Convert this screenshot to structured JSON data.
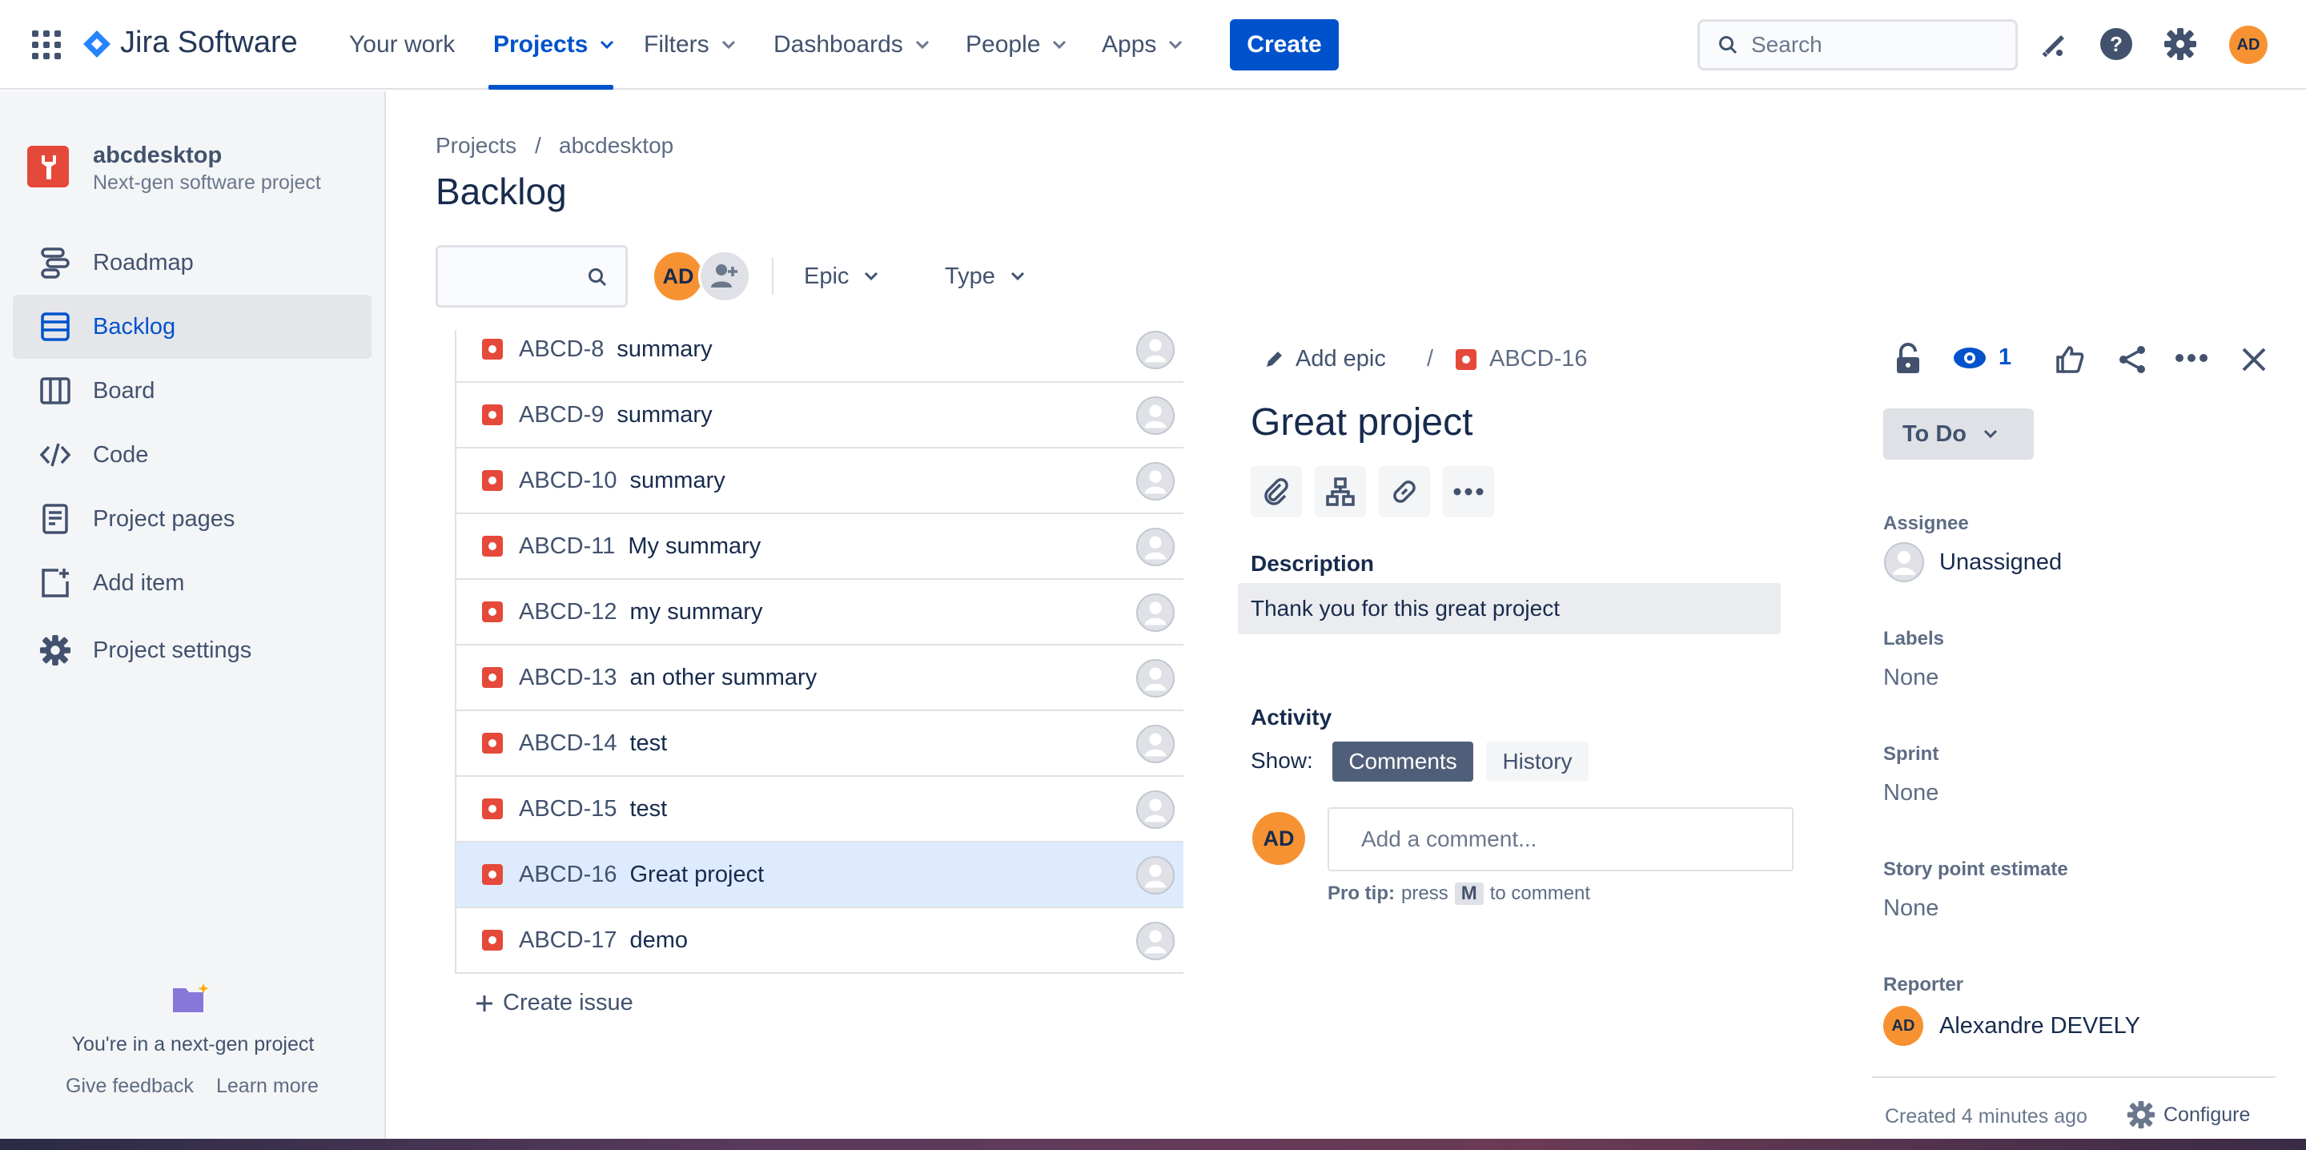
{
  "topnav": {
    "brand": "Jira Software",
    "items": [
      {
        "label": "Your work"
      },
      {
        "label": "Projects"
      },
      {
        "label": "Filters"
      },
      {
        "label": "Dashboards"
      },
      {
        "label": "People"
      },
      {
        "label": "Apps"
      }
    ],
    "create_label": "Create",
    "search_placeholder": "Search",
    "avatar_initials": "AD"
  },
  "sidebar": {
    "project_name": "abcdesktop",
    "project_type": "Next-gen software project",
    "items": [
      {
        "label": "Roadmap"
      },
      {
        "label": "Backlog"
      },
      {
        "label": "Board"
      },
      {
        "label": "Code"
      },
      {
        "label": "Project pages"
      },
      {
        "label": "Add item"
      },
      {
        "label": "Project settings"
      }
    ],
    "footer_text": "You're in a next-gen project",
    "give_feedback": "Give feedback",
    "learn_more": "Learn more"
  },
  "main": {
    "breadcrumb": [
      "Projects",
      "abcdesktop"
    ],
    "breadcrumb_sep": "/",
    "title": "Backlog",
    "filter_avatar": "AD",
    "filters": {
      "epic": "Epic",
      "type": "Type"
    },
    "issues": [
      {
        "key": "ABCD-8",
        "summary": "summary"
      },
      {
        "key": "ABCD-9",
        "summary": "summary"
      },
      {
        "key": "ABCD-10",
        "summary": "summary"
      },
      {
        "key": "ABCD-11",
        "summary": "My summary"
      },
      {
        "key": "ABCD-12",
        "summary": "my summary"
      },
      {
        "key": "ABCD-13",
        "summary": "an other summary"
      },
      {
        "key": "ABCD-14",
        "summary": "test"
      },
      {
        "key": "ABCD-15",
        "summary": "test"
      },
      {
        "key": "ABCD-16",
        "summary": "Great project"
      },
      {
        "key": "ABCD-17",
        "summary": "demo"
      }
    ],
    "create_issue": "Create issue"
  },
  "detail": {
    "add_epic": "Add epic",
    "sep": "/",
    "issue_key": "ABCD-16",
    "watch_count": "1",
    "title": "Great project",
    "description_label": "Description",
    "description": "Thank you for this great project",
    "activity_label": "Activity",
    "show_label": "Show:",
    "comments_tab": "Comments",
    "history_tab": "History",
    "comment_avatar": "AD",
    "comment_placeholder": "Add a comment...",
    "pro_tip_bold": "Pro tip:",
    "pro_tip_press": "press",
    "pro_tip_key": "M",
    "pro_tip_rest": "to comment",
    "status": "To Do",
    "assignee_label": "Assignee",
    "assignee": "Unassigned",
    "labels_label": "Labels",
    "labels": "None",
    "sprint_label": "Sprint",
    "sprint": "None",
    "story_label": "Story point estimate",
    "story": "None",
    "reporter_label": "Reporter",
    "reporter_initials": "AD",
    "reporter": "Alexandre DEVELY",
    "created": "Created 4 minutes ago",
    "configure": "Configure"
  },
  "colors": {
    "primary": "#0052CC",
    "bug": "#E5493A",
    "avatar": "#F79232",
    "selected_row": "#DEEBFF"
  }
}
